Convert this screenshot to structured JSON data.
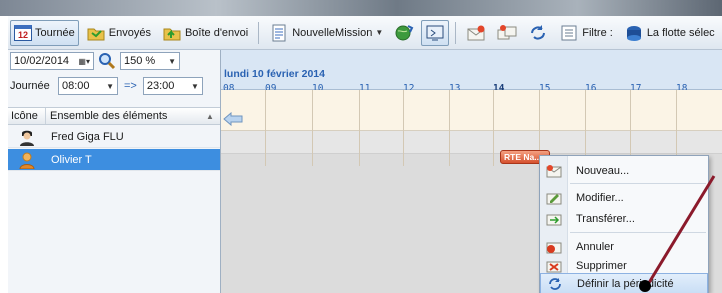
{
  "toolbar": {
    "tournee": "Tournée",
    "tournee_date_num": "12",
    "envoyes": "Envoyés",
    "boite_envoi": "Boîte d'envoi",
    "nouvelle_mission": "NouvelleMission",
    "filtre": "Filtre :",
    "flotte": "La flotte sélec"
  },
  "controls": {
    "date_value": "10/02/2014",
    "zoom_value": "150 %",
    "journee_label": "Journée",
    "start_time": "08:00",
    "arrow_label": "=>",
    "end_time": "23:00"
  },
  "resource_grid": {
    "col_icon": "Icône",
    "col_elements": "Ensemble des éléments",
    "rows": [
      {
        "name": "Fred Giga FLU",
        "selected": false
      },
      {
        "name": "Olivier T",
        "selected": true
      }
    ]
  },
  "schedule": {
    "day_title": "lundi 10 février 2014",
    "hours": [
      "08",
      "09",
      "10",
      "11",
      "12",
      "13",
      "14",
      "15",
      "16",
      "17",
      "18"
    ],
    "highlight_hour": "14",
    "appointment_label": "RTE Na..."
  },
  "context_menu": {
    "items": [
      {
        "label": "Nouveau...",
        "icon": "new-appointment-icon"
      },
      {
        "label": "Modifier...",
        "icon": "edit-icon"
      },
      {
        "label": "Transférer...",
        "icon": "transfer-icon"
      },
      {
        "label": "Annuler",
        "icon": "cancel-icon"
      },
      {
        "label": "Supprimer",
        "icon": "delete-icon"
      },
      {
        "label": "Définir la périodicité",
        "icon": "recurrence-icon",
        "highlighted": true
      }
    ]
  },
  "colors": {
    "selection": "#3d8ee0",
    "appointment": "#d6512e",
    "annotation": "#8b1a2b"
  }
}
